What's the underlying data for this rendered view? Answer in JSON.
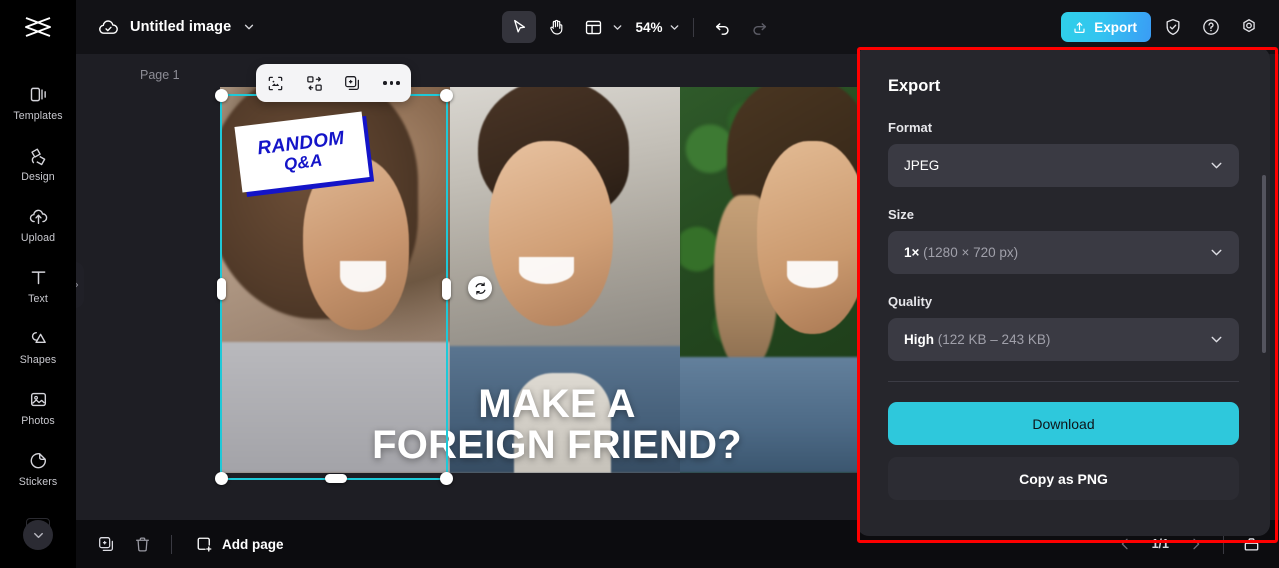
{
  "app": {
    "logo_icon": "capcut-logo-icon",
    "document": {
      "cloud_icon": "cloud-check-icon",
      "title": "Untitled image",
      "dropdown_icon": "chevron-down-icon"
    }
  },
  "toolbar": {
    "select_tool": {
      "icon": "cursor-arrow-icon",
      "active": true
    },
    "hand_tool": {
      "icon": "hand-icon",
      "active": false
    },
    "layout_tool": {
      "icon": "layout-grid-icon",
      "chevron": "chevron-down-icon"
    },
    "zoom": {
      "value": "54%",
      "chevron": "chevron-down-icon"
    },
    "undo": {
      "icon": "undo-icon",
      "enabled": true
    },
    "redo": {
      "icon": "redo-icon",
      "enabled": false
    },
    "export_button": {
      "label": "Export",
      "icon": "upload-icon"
    },
    "shield_button": {
      "icon": "shield-check-icon"
    },
    "help_button": {
      "icon": "question-circle-icon"
    },
    "settings_button": {
      "icon": "settings-gear-icon"
    }
  },
  "sidebar": {
    "items": [
      {
        "label": "Templates",
        "icon": "templates-icon"
      },
      {
        "label": "Design",
        "icon": "design-icon"
      },
      {
        "label": "Upload",
        "icon": "upload-cloud-icon"
      },
      {
        "label": "Text",
        "icon": "text-t-icon"
      },
      {
        "label": "Shapes",
        "icon": "shapes-icon"
      },
      {
        "label": "Photos",
        "icon": "photo-image-icon"
      },
      {
        "label": "Stickers",
        "icon": "sticker-icon"
      }
    ],
    "collapse_icon": "chevron-down-icon",
    "panel_handle_icon": "chevron-right-icon"
  },
  "canvas": {
    "page_label": "Page 1",
    "floating_tools": [
      {
        "icon": "cutout-select-icon"
      },
      {
        "icon": "replace-swap-icon"
      },
      {
        "icon": "duplicate-icon"
      },
      {
        "icon": "more-horizontal-icon"
      }
    ],
    "rotate_icon": "rotate-icon",
    "artwork": {
      "sticker": {
        "line1": "RANDOM",
        "line2": "Q&A",
        "color": "#1414c8"
      },
      "headline_line1": "MAKE A",
      "headline_line2": "FOREIGN FRIEND?"
    }
  },
  "bottom_bar": {
    "duplicate_page": {
      "icon": "duplicate-page-icon"
    },
    "delete_page": {
      "icon": "trash-icon"
    },
    "add_page": {
      "label": "Add page",
      "icon": "add-page-icon"
    },
    "prev_page": {
      "icon": "chevron-left-icon"
    },
    "page_count": "1/1",
    "next_page": {
      "icon": "chevron-right-icon"
    },
    "present": {
      "icon": "present-icon"
    }
  },
  "export_panel": {
    "title": "Export",
    "format": {
      "label": "Format",
      "value": "JPEG",
      "chevron": "chevron-down-icon"
    },
    "size": {
      "label": "Size",
      "value_bold": "1×",
      "value_muted": "(1280 × 720 px)",
      "chevron": "chevron-down-icon"
    },
    "quality": {
      "label": "Quality",
      "value_bold": "High",
      "value_muted": "(122 KB – 243 KB)",
      "chevron": "chevron-down-icon"
    },
    "download_label": "Download",
    "copy_label": "Copy as PNG",
    "accent_color": "#2ec8dc",
    "highlight_color": "#ff0000"
  }
}
